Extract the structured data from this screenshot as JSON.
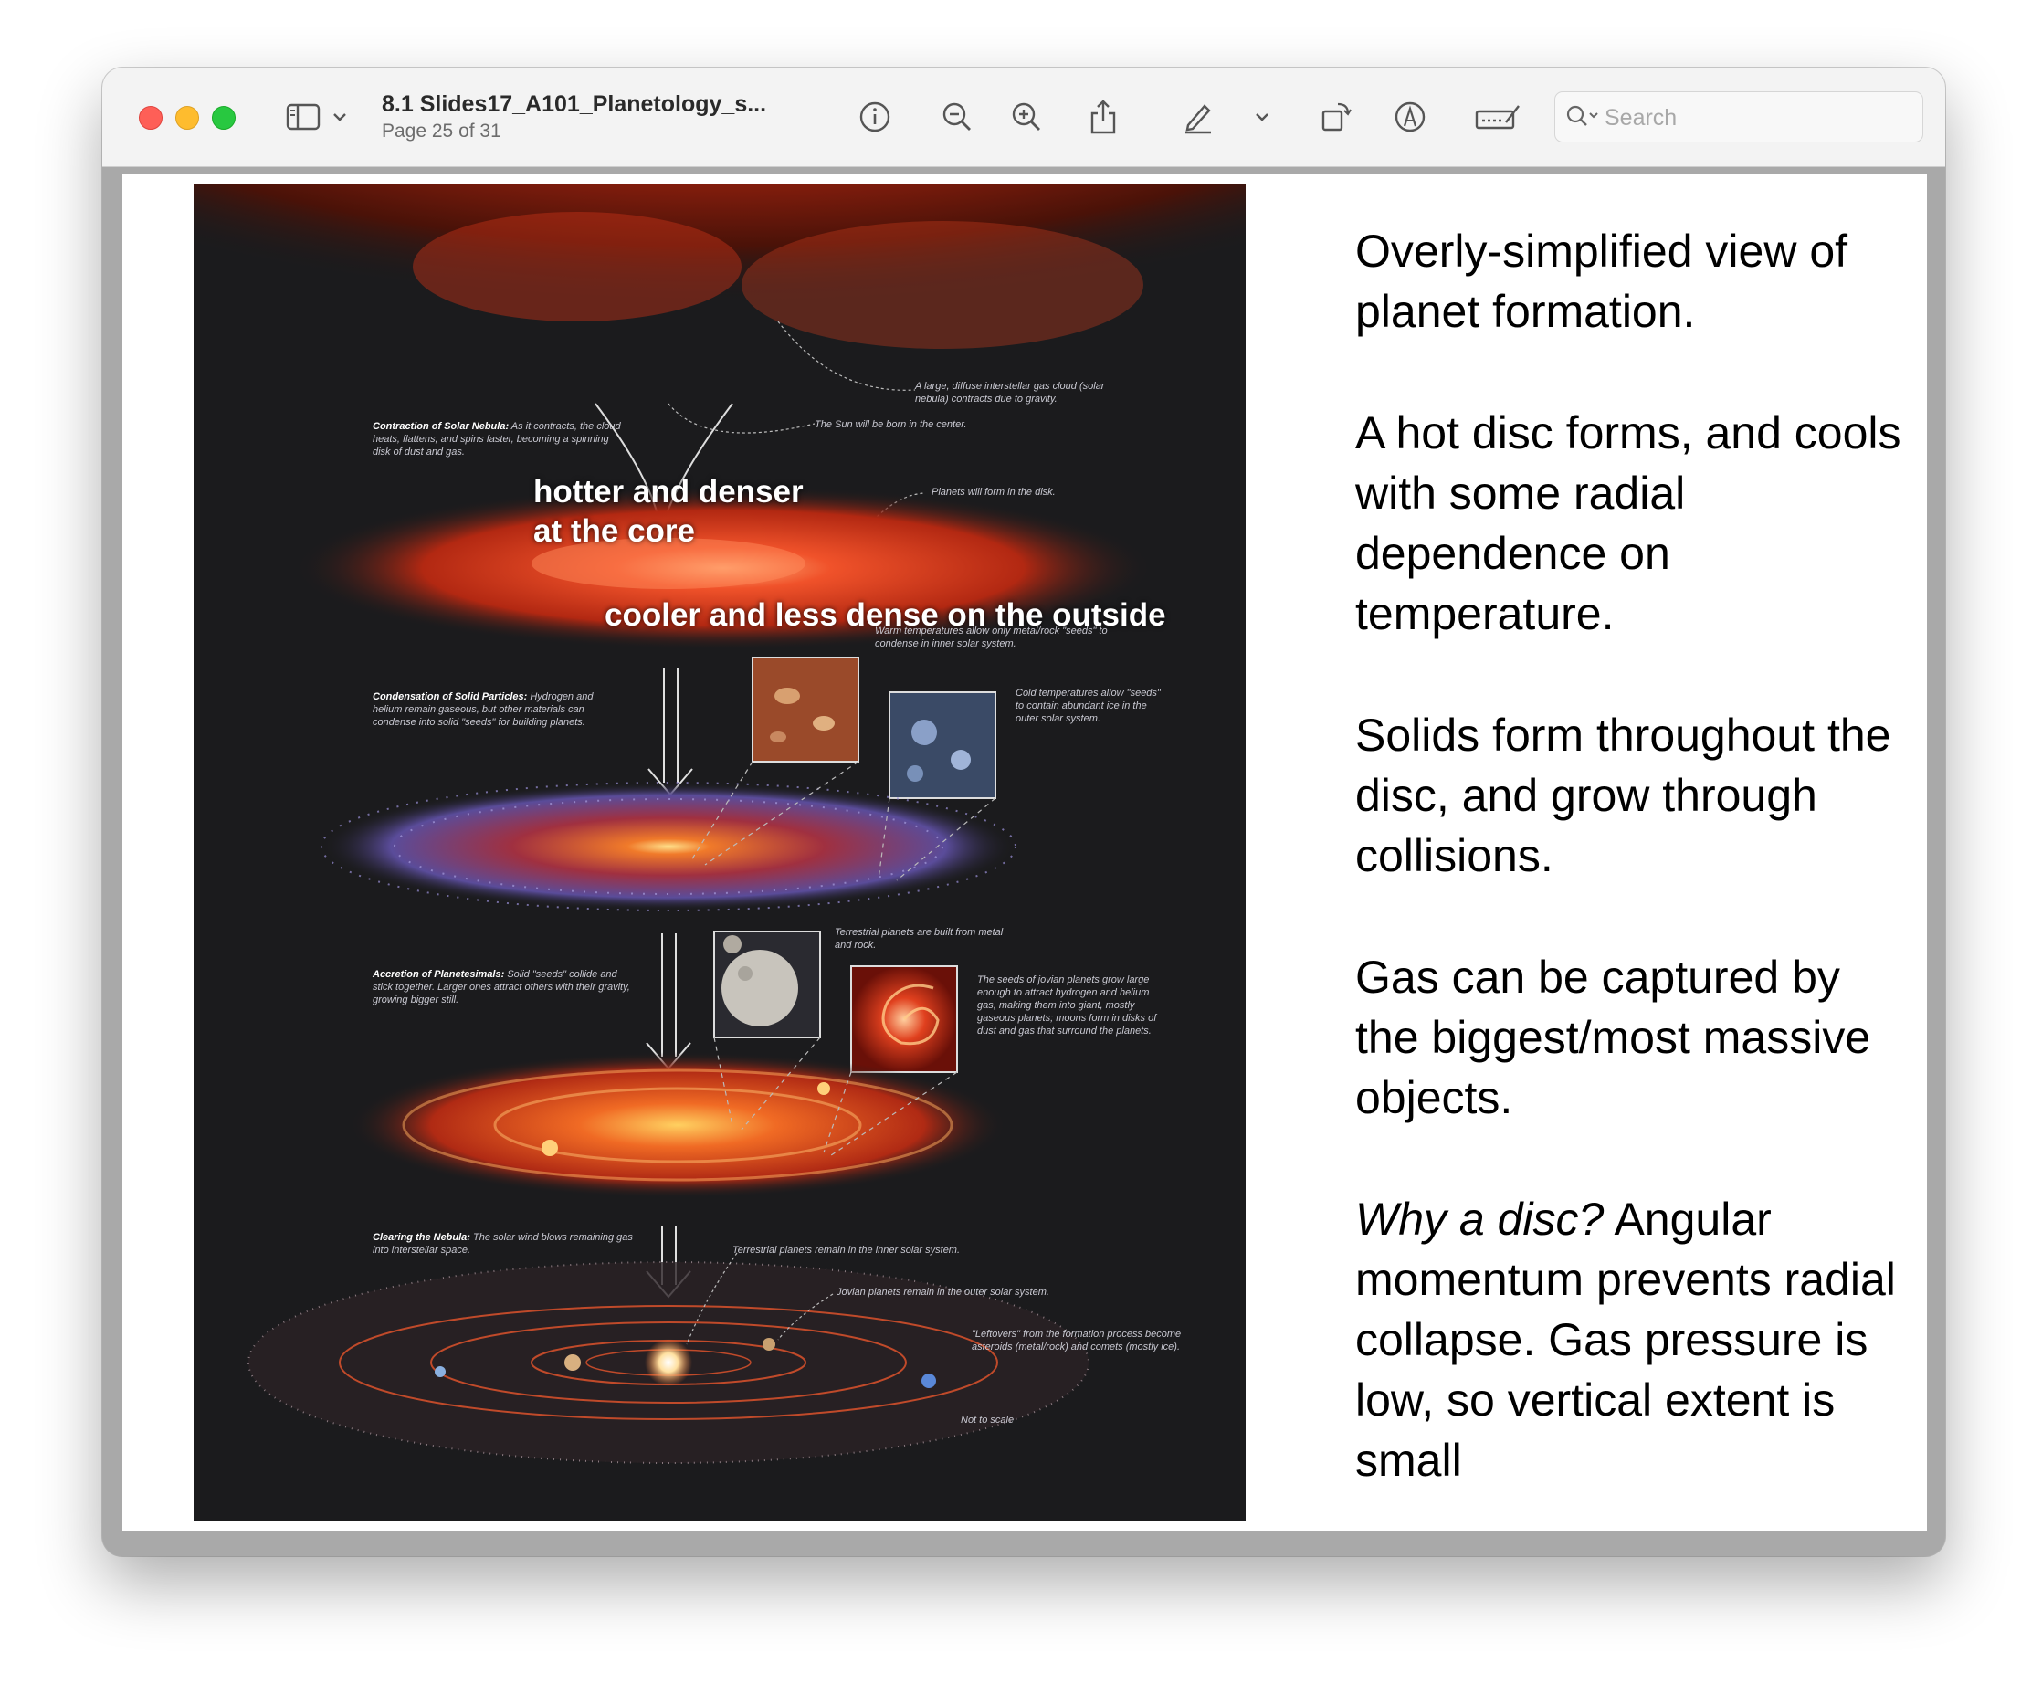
{
  "window": {
    "title": "8.1 Slides17_A101_Planetology_s...",
    "subtitle": "Page 25 of 31"
  },
  "toolbar": {
    "icons": [
      "sidebar-icon",
      "chevron-down-icon",
      "info-icon",
      "zoom-out-icon",
      "zoom-in-icon",
      "share-icon",
      "markup-pen-icon",
      "chevron-down-icon",
      "rotate-icon",
      "annotate-icon",
      "signature-form-icon"
    ],
    "search_placeholder": "Search"
  },
  "figure": {
    "overlay_core": "hotter and denser\nat the core",
    "overlay_outside": "cooler and less dense on the outside",
    "stages": [
      {
        "title": "Contraction of Solar Nebula:",
        "text": "As it contracts, the cloud heats, flattens, and spins faster, becoming a spinning disk of dust and gas."
      },
      {
        "title": "Condensation of Solid Particles:",
        "text": "Hydrogen and helium remain gaseous, but other materials can condense into solid \"seeds\" for building planets."
      },
      {
        "title": "Accretion of Planetesimals:",
        "text": "Solid \"seeds\" collide and stick together. Larger ones attract others with their gravity, growing bigger still."
      },
      {
        "title": "Clearing the Nebula:",
        "text": "The solar wind blows remaining gas into interstellar space."
      }
    ],
    "notes": [
      "A large, diffuse interstellar gas cloud (solar nebula) contracts due to gravity.",
      "The Sun will be born in the center.",
      "Planets will form in the disk.",
      "Warm temperatures allow only metal/rock \"seeds\" to condense in inner solar system.",
      "Cold temperatures allow \"seeds\" to contain abundant ice in the outer solar system.",
      "Terrestrial planets are built from metal and rock.",
      "The seeds of jovian planets grow large enough to attract hydrogen and helium gas, making them into giant, mostly gaseous planets; moons form in disks of dust and gas that surround the planets.",
      "Terrestrial planets remain in the inner solar system.",
      "Jovian planets remain in the outer solar system.",
      "\"Leftovers\" from the formation process become asteroids (metal/rock) and comets (mostly ice).",
      "Not to scale"
    ]
  },
  "slide": {
    "p1": "Overly-simplified view of planet formation.",
    "p2": "A hot disc forms, and cools with some radial dependence on temperature.",
    "p3": "Solids form throughout the disc, and grow through collisions.",
    "p4": "Gas can be captured by the biggest/most massive objects.",
    "p5_italic": "Why a disc?",
    "p5_rest": " Angular momentum prevents radial collapse. Gas pressure is low, so vertical extent is small"
  },
  "colors": {
    "accent_red": "#fe5f57",
    "accent_yellow": "#febc2e",
    "accent_green": "#28c840",
    "figure_bg": "#1b1b1d",
    "nebula_red": "#c83418"
  }
}
